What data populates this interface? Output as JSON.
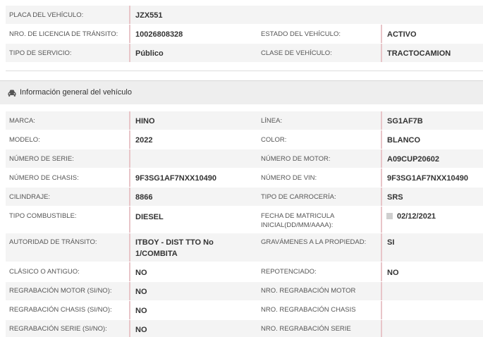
{
  "top": {
    "placa_label": "PLACA DEL VEHÍCULO:",
    "placa_value": "JZX551",
    "licencia_label": "NRO. DE LICENCIA DE TRÁNSITO:",
    "licencia_value": "10026808328",
    "estado_label": "ESTADO DEL VEHÍCULO:",
    "estado_value": "ACTIVO",
    "servicio_label": "TIPO DE SERVICIO:",
    "servicio_value": "Público",
    "clase_label": "CLASE DE VEHÍCULO:",
    "clase_value": "TRACTOCAMION"
  },
  "section": {
    "icon": "car-icon",
    "title": "Información general del vehículo"
  },
  "general": {
    "marca_label": "MARCA:",
    "marca_value": "HINO",
    "linea_label": "LÍNEA:",
    "linea_value": "SG1AF7B",
    "modelo_label": "MODELO:",
    "modelo_value": "2022",
    "color_label": "COLOR:",
    "color_value": "BLANCO",
    "serie_label": "NÚMERO DE SERIE:",
    "serie_value": "",
    "motor_label": "NÚMERO DE MOTOR:",
    "motor_value": "A09CUP20602",
    "chasis_label": "NÚMERO DE CHASIS:",
    "chasis_value": "9F3SG1AF7NXX10490",
    "vin_label": "NÚMERO DE VIN:",
    "vin_value": "9F3SG1AF7NXX10490",
    "cilindraje_label": "CILINDRAJE:",
    "cilindraje_value": "8866",
    "carroceria_label": "TIPO DE CARROCERÍA:",
    "carroceria_value": "SRS",
    "combustible_label": "TIPO COMBUSTIBLE:",
    "combustible_value": "DIESEL",
    "matricula_label_1": "FECHA DE MATRICULA",
    "matricula_label_2": "INICIAL(DD/MM/AAAA):",
    "matricula_value": "02/12/2021",
    "autoridad_label": "AUTORIDAD DE TRÁNSITO:",
    "autoridad_value_1": "ITBOY - DIST TTO No",
    "autoridad_value_2": "1/COMBITA",
    "gravamenes_label": "GRAVÁMENES A LA PROPIEDAD:",
    "gravamenes_value": "SI",
    "clasico_label": "CLÁSICO O ANTIGUO:",
    "clasico_value": "NO",
    "repotenciado_label": "REPOTENCIADO:",
    "repotenciado_value": "NO",
    "reg_motor_label": "REGRABACIÓN MOTOR (SI/NO):",
    "reg_motor_value": "NO",
    "nro_reg_motor_label": "NRO. REGRABACIÓN MOTOR",
    "nro_reg_motor_value": "",
    "reg_chasis_label": "REGRABACIÓN CHASIS (SI/NO):",
    "reg_chasis_value": "NO",
    "nro_reg_chasis_label": "NRO. REGRABACIÓN CHASIS",
    "nro_reg_chasis_value": "",
    "reg_serie_label": "REGRABACIÓN SERIE (SI/NO):",
    "reg_serie_value": "NO",
    "nro_reg_serie_label": "NRO. REGRABACIÓN SERIE",
    "nro_reg_serie_value": ""
  }
}
